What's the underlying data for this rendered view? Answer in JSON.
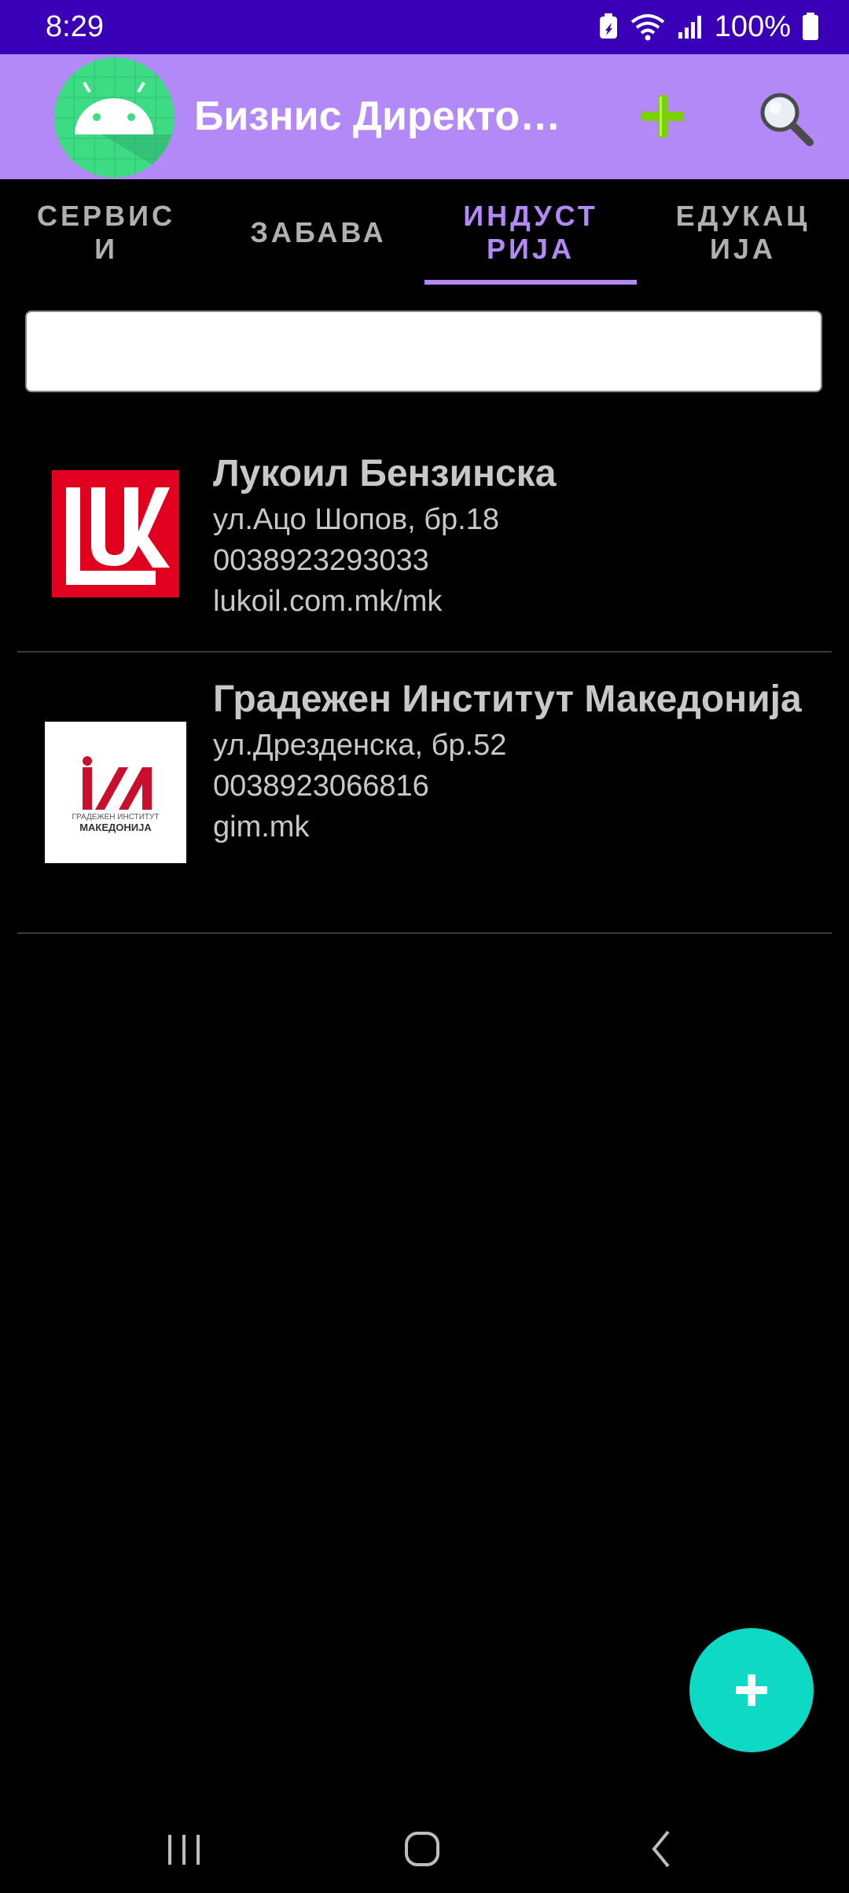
{
  "status_bar": {
    "time": "8:29",
    "battery_percent": "100%",
    "icons": [
      "battery-saver-icon",
      "wifi-icon",
      "signal-icon",
      "battery-icon"
    ]
  },
  "app_bar": {
    "title": "Бизнис Директо…",
    "logo_icon": "android-icon",
    "add_icon": "plus-icon",
    "search_icon": "search-icon",
    "colors": {
      "background": "#b388f7",
      "add_icon": "#7ccf00"
    }
  },
  "tabs": [
    {
      "label": "СЕРВИСИ",
      "active": false
    },
    {
      "label": "ЗАБАВА",
      "active": false
    },
    {
      "label": "ИНДУСТРИЈА",
      "active": true
    },
    {
      "label": "ЕДУКАЦИЈА",
      "active": false
    }
  ],
  "search": {
    "value": "",
    "placeholder": ""
  },
  "businesses": [
    {
      "name": "Лукоил Бензинска",
      "address": "ул.Ацо Шопов, бр.18",
      "phone": "0038923293033",
      "website": "lukoil.com.mk/mk",
      "logo_text": "LUK",
      "logo_color": "#e1001d"
    },
    {
      "name": "Градежен Институт Македонија",
      "address": "ул.Дрезденска, бр.52",
      "phone": "0038923066816",
      "website": "gim.mk",
      "logo_mark": "ИИ",
      "logo_caption_1": "ГРАДЕЖЕН ИНСТИТУТ",
      "logo_caption_2": "МАКЕДОНИЈА",
      "logo_color": "#c8102e"
    }
  ],
  "fab": {
    "icon": "plus-icon",
    "color": "#0dd9c5"
  },
  "nav_bar": {
    "icons": [
      "recents-icon",
      "home-icon",
      "back-icon"
    ]
  }
}
